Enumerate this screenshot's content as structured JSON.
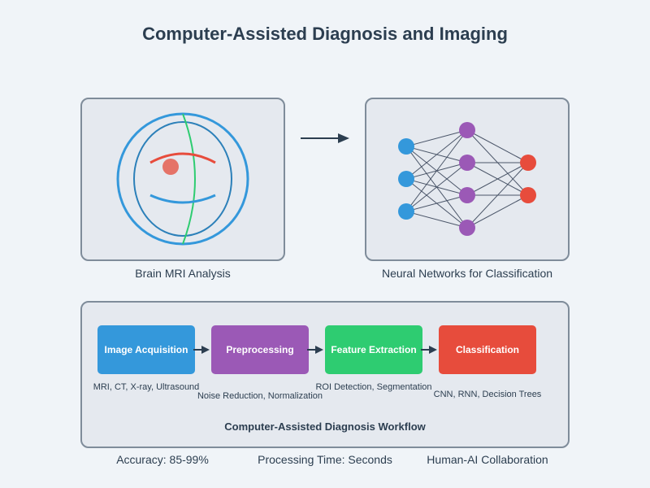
{
  "title": "Computer-Assisted Diagnosis and Imaging",
  "panels": {
    "mri_caption": "Brain MRI Analysis",
    "nn_caption": "Neural Networks for Classification"
  },
  "colors": {
    "blue": "#3498db",
    "purple": "#9b59b6",
    "green": "#2ecc71",
    "red": "#e74c3c",
    "dark": "#2c3e50"
  },
  "workflow": {
    "title": "Computer-Assisted Diagnosis Workflow",
    "stages": [
      {
        "label": "Image Acquisition",
        "detail": "MRI, CT, X-ray, Ultrasound"
      },
      {
        "label": "Preprocessing",
        "detail": "Noise Reduction, Normalization"
      },
      {
        "label": "Feature Extraction",
        "detail": "ROI Detection, Segmentation"
      },
      {
        "label": "Classification",
        "detail": "CNN, RNN, Decision Trees"
      }
    ]
  },
  "stats": [
    "Accuracy: 85-99%",
    "Processing Time: Seconds",
    "Human-AI Collaboration"
  ]
}
